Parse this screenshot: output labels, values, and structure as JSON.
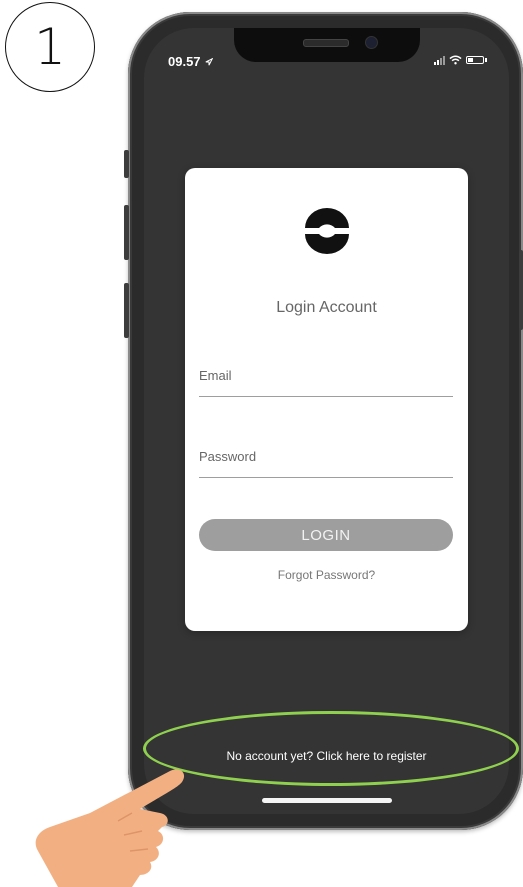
{
  "step_badge": "1",
  "status_bar": {
    "time": "09.57",
    "location_icon": "location-arrow-icon",
    "signal_icon": "cellular-signal-icon",
    "wifi_icon": "wifi-icon",
    "battery_icon": "battery-icon"
  },
  "login_card": {
    "logo_icon": "brand-logo-icon",
    "title": "Login Account",
    "email_label": "Email",
    "password_label": "Password",
    "login_button": "LOGIN",
    "forgot_link": "Forgot Password?"
  },
  "register_link": "No account yet? Click here to register",
  "colors": {
    "screen_background": "#343434",
    "card_background": "#ffffff",
    "button_background": "#9e9e9e",
    "highlight": "#8fd14f",
    "hand": "#f2b082"
  }
}
